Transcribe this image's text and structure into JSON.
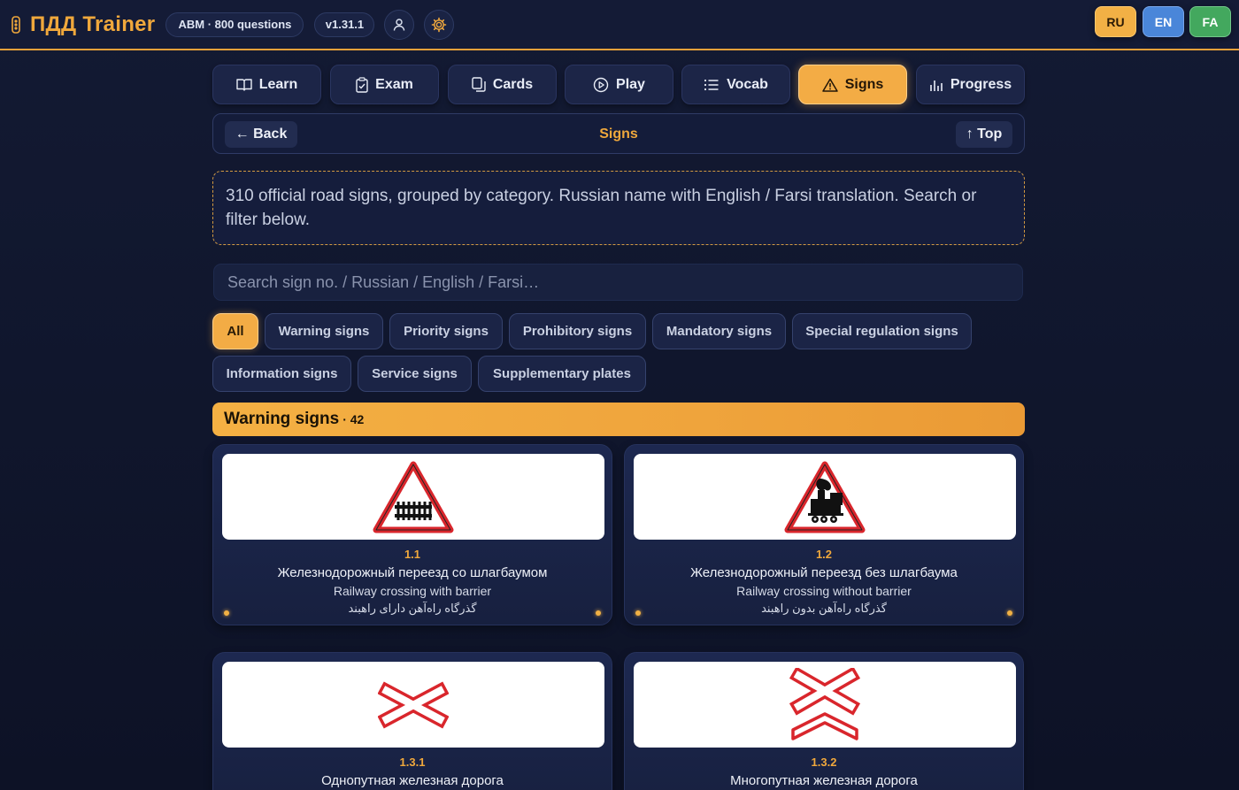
{
  "header": {
    "brand": "ПДД Trainer",
    "set_badge": "ABM · 800 questions",
    "version": "v1.31.1",
    "langs": [
      "RU",
      "EN",
      "FA"
    ],
    "icons": [
      "traffic-light-icon",
      "user-icon",
      "gear-icon"
    ]
  },
  "nav": {
    "tabs": [
      {
        "label": "Learn",
        "icon": "book-icon"
      },
      {
        "label": "Exam",
        "icon": "clipboard-check-icon"
      },
      {
        "label": "Cards",
        "icon": "cards-icon"
      },
      {
        "label": "Play",
        "icon": "play-icon"
      },
      {
        "label": "Vocab",
        "icon": "list-icon"
      },
      {
        "label": "Signs",
        "icon": "warning-icon",
        "active": true
      },
      {
        "label": "Progress",
        "icon": "bar-chart-icon"
      }
    ]
  },
  "subheader": {
    "back": "← Back",
    "title": "Signs",
    "top": "↑ Top"
  },
  "info_text": "310 official road signs, grouped by category. Russian name with English / Farsi translation. Search or filter below.",
  "search": {
    "placeholder": "Search sign no. / Russian / English / Farsi…",
    "value": ""
  },
  "filters": [
    {
      "label": "All",
      "active": true
    },
    {
      "label": "Warning signs"
    },
    {
      "label": "Priority signs"
    },
    {
      "label": "Prohibitory signs"
    },
    {
      "label": "Mandatory signs"
    },
    {
      "label": "Special regulation signs"
    },
    {
      "label": "Information signs"
    },
    {
      "label": "Service signs"
    },
    {
      "label": "Supplementary plates"
    }
  ],
  "section": {
    "title": "Warning signs",
    "count": "· 42"
  },
  "signs": [
    {
      "no": "1.1",
      "ru": "Железнодорожный переезд со шлагбаумом",
      "en": "Railway crossing with barrier",
      "fa": "گذرگاه راه‌آهن دارای راهبند"
    },
    {
      "no": "1.2",
      "ru": "Железнодорожный переезд без шлагбаума",
      "en": "Railway crossing without barrier",
      "fa": "گذرگاه راه‌آهن بدون راهبند"
    },
    {
      "no": "1.3.1",
      "ru": "Однопутная железная дорога",
      "en": "",
      "fa": ""
    },
    {
      "no": "1.3.2",
      "ru": "Многопутная железная дорога",
      "en": "",
      "fa": ""
    }
  ],
  "colors": {
    "accent": "#f0a83c",
    "background": "#131a33",
    "sign_red": "#d9262c"
  }
}
